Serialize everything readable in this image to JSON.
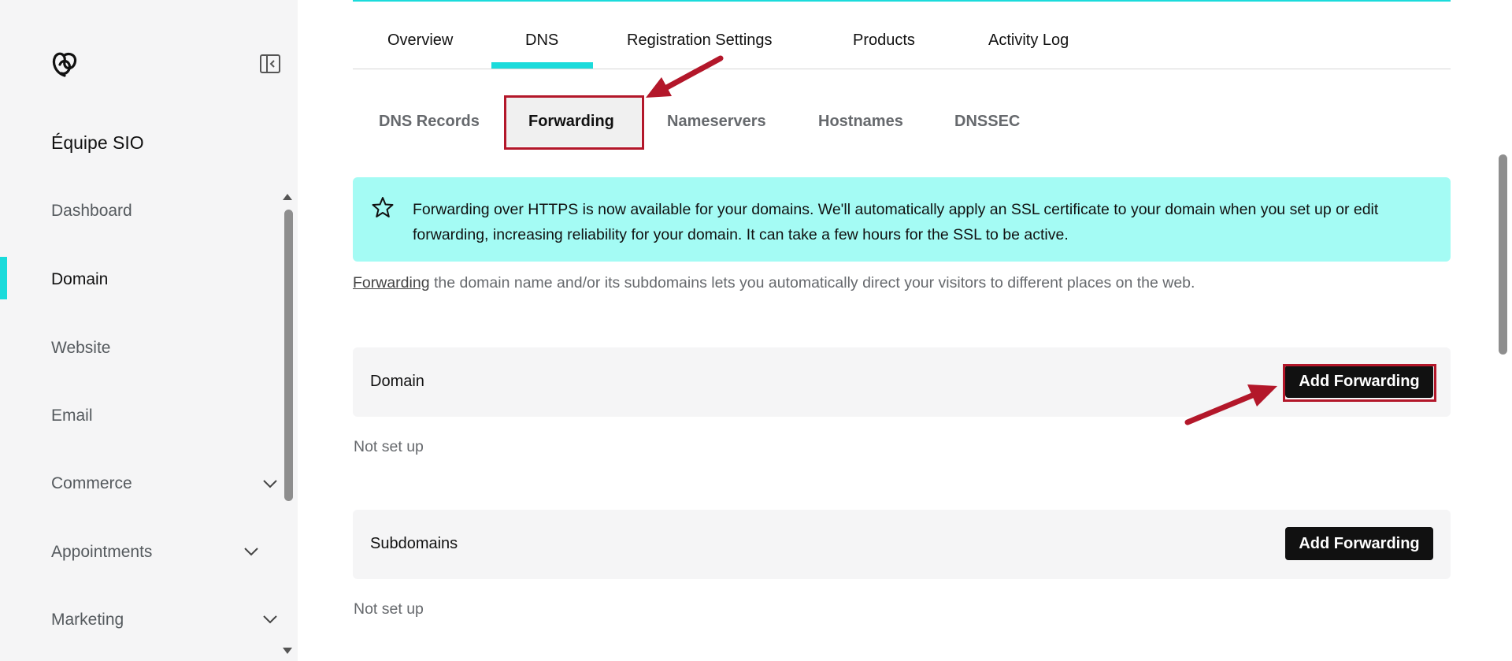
{
  "sidebar": {
    "workspace_name": "Équipe SIO",
    "logo_icon": "godaddy-logo-icon",
    "collapse_icon": "sidebar-collapse-icon",
    "active_color": "#1bdbdb",
    "items": [
      {
        "label": "Dashboard",
        "expandable": false
      },
      {
        "label": "Domain",
        "expandable": false,
        "active": true
      },
      {
        "label": "Website",
        "expandable": false
      },
      {
        "label": "Email",
        "expandable": false
      },
      {
        "label": "Commerce",
        "expandable": true
      },
      {
        "label": "Appointments",
        "expandable": true
      },
      {
        "label": "Marketing",
        "expandable": true
      }
    ]
  },
  "tabs": {
    "items": [
      {
        "label": "Overview"
      },
      {
        "label": "DNS",
        "active": true
      },
      {
        "label": "Registration Settings"
      },
      {
        "label": "Products"
      },
      {
        "label": "Activity Log"
      }
    ]
  },
  "subtabs": {
    "items": [
      {
        "label": "DNS Records"
      },
      {
        "label": "Forwarding",
        "active": true
      },
      {
        "label": "Nameservers"
      },
      {
        "label": "Hostnames"
      },
      {
        "label": "DNSSEC"
      }
    ]
  },
  "banner": {
    "icon": "star-icon",
    "background": "#a4fbf4",
    "text": "Forwarding over HTTPS is now available for your domains. We'll automatically apply an SSL certificate to your domain when you set up or edit forwarding, increasing reliability for your domain. It can take a few hours for the SSL to be active."
  },
  "intro": {
    "link_text": "Forwarding",
    "rest_text": " the domain name and/or its subdomains lets you automatically direct your visitors to different places on the web."
  },
  "sections": [
    {
      "title": "Domain",
      "button_label": "Add Forwarding",
      "status": "Not set up"
    },
    {
      "title": "Subdomains",
      "button_label": "Add Forwarding",
      "status": "Not set up"
    }
  ],
  "annotations": {
    "color": "#b3172a"
  }
}
